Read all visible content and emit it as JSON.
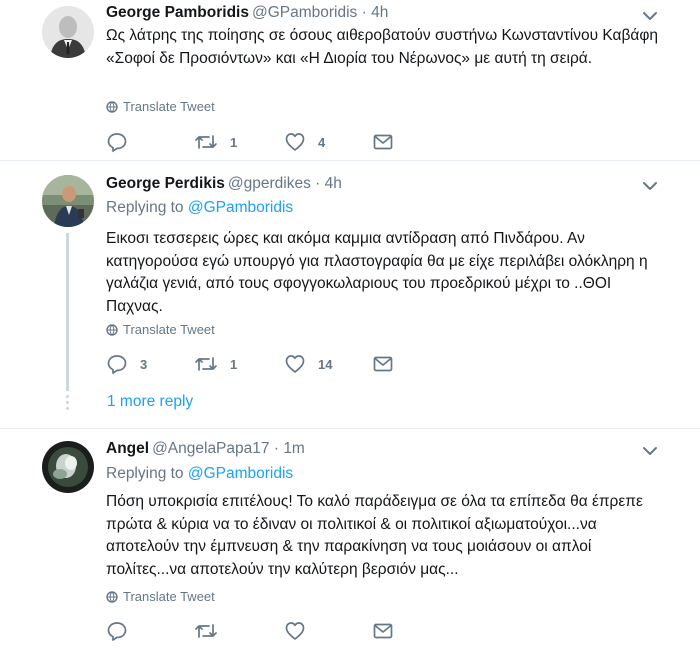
{
  "tweets": [
    {
      "name": "George Pamboridis",
      "handle": "@GPamboridis",
      "separator": "·",
      "time": "4h",
      "text": "Ως λάτρης της ποίησης σε όσους αιθεροβατούν συστήνω Κωνσταντίνου Καβάφη «Σοφοί δε Προσιόντων» και «Η Διορία του Νέρωνος» με αυτή τη σειρά.",
      "translate": "Translate Tweet",
      "replies": "",
      "retweets": "1",
      "likes": "4"
    },
    {
      "name": "George Perdikis",
      "handle": "@gperdikes",
      "separator": "·",
      "time": "4h",
      "replying_prefix": "Replying to",
      "replying_to": "@GPamboridis",
      "text": "Εικοσι τεσσερεις ώρες και ακόμα καμμια αντίδραση από Πινδάρου. Αν κατηγορούσα εγώ υπουργό για πλαστογραφία θα με είχε περιλάβει ολόκληρη η γαλάζια γενιά, από τους σφογγοκωλαριους του προεδρικού μέχρι το ..ΘΟΙ Παχνας.",
      "translate": "Translate Tweet",
      "replies": "3",
      "retweets": "1",
      "likes": "14"
    },
    {
      "name": "Angel",
      "handle": "@AngelaPapa17",
      "separator": "·",
      "time": "1m",
      "replying_prefix": "Replying to",
      "replying_to": "@GPamboridis",
      "text": "Πόση υποκρισία επιτέλους! Το καλό παράδειγμα σε όλα τα επίπεδα θα έπρεπε πρώτα & κύρια να το έδιναν οι πολιτικοί & οι πολιτικοί αξιωματούχοι...να αποτελούν την έμπνευση & την παρακίνηση να τους μοιάσουν οι απλοί πολίτες...να αποτελούν την καλύτερη βερσιόν μας...",
      "translate": "Translate Tweet",
      "replies": "",
      "retweets": "",
      "likes": ""
    }
  ],
  "thread": {
    "more_reply": "1 more reply"
  },
  "icons": {
    "caret": "chevron-down-icon",
    "reply": "reply-icon",
    "retweet": "retweet-icon",
    "like": "heart-icon",
    "dm": "envelope-icon",
    "translate": "globe-icon"
  },
  "colors": {
    "link": "#1da1f2",
    "muted": "#657786",
    "text": "#14171a",
    "divider": "#e6ecf0",
    "thread": "#ccd6dd"
  }
}
